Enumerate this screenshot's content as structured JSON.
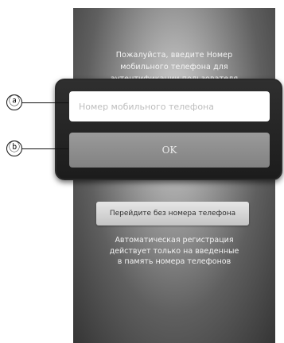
{
  "screen": {
    "instruction_lines": [
      "Пожалуйста, введите Номер",
      "мобильного телефона для",
      "аутентификации пользователя"
    ],
    "skip_button_label": "Перейдите без номера телефона",
    "note_lines": [
      "Автоматическая регистрация",
      "действует только на введенные",
      "в память номера телефонов"
    ]
  },
  "dialog": {
    "phone_input": {
      "value": "",
      "placeholder": "Номер мобильного телефона"
    },
    "ok_label": "OK"
  },
  "callouts": {
    "a": "ⓐ",
    "b": "ⓑ"
  }
}
